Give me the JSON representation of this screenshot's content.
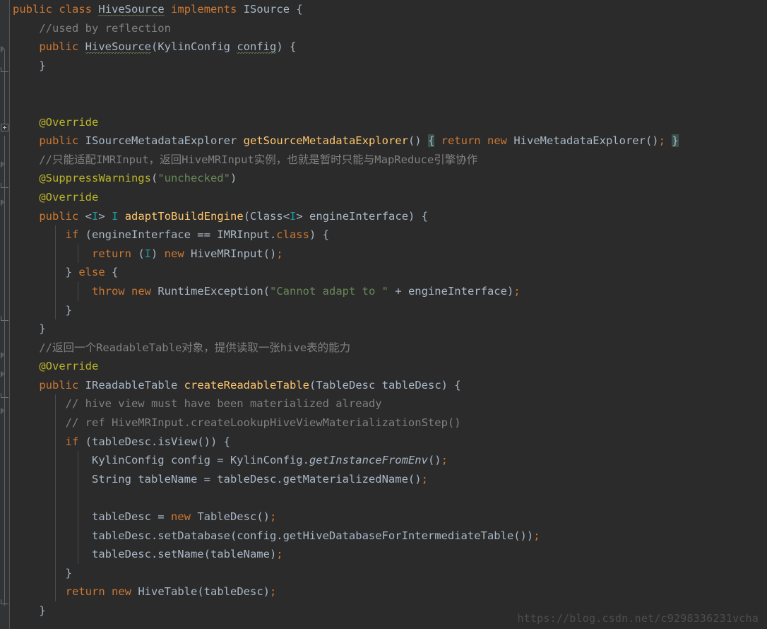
{
  "editor": {
    "theme": "darcula",
    "background_color": "#2b2b2b",
    "gutter_color": "#313335",
    "default_text_color": "#a9b7c6"
  },
  "watermark": {
    "text": "https://blog.csdn.net/c9298336231vcha",
    "color": "#4e4e4e"
  },
  "code": {
    "language": "Java",
    "lines": [
      {
        "n": 1,
        "text": "public class HiveSource implements ISource {"
      },
      {
        "n": 2,
        "text": "    //used by reflection"
      },
      {
        "n": 3,
        "text": "    public HiveSource(KylinConfig config) {"
      },
      {
        "n": 4,
        "text": "    }"
      },
      {
        "n": 5,
        "text": ""
      },
      {
        "n": 6,
        "text": ""
      },
      {
        "n": 7,
        "text": "    @Override"
      },
      {
        "n": 8,
        "text": "    public ISourceMetadataExplorer getSourceMetadataExplorer() { return new HiveMetadataExplorer(); }"
      },
      {
        "n": 9,
        "text": "    //只能适配IMRInput，返回HiveMRInput实例，也就是暂时只能与MapReduce引擎协作"
      },
      {
        "n": 10,
        "text": "    @SuppressWarnings(\"unchecked\")"
      },
      {
        "n": 11,
        "text": "    @Override"
      },
      {
        "n": 12,
        "text": "    public <I> I adaptToBuildEngine(Class<I> engineInterface) {"
      },
      {
        "n": 13,
        "text": "        if (engineInterface == IMRInput.class) {"
      },
      {
        "n": 14,
        "text": "            return (I) new HiveMRInput();"
      },
      {
        "n": 15,
        "text": "        } else {"
      },
      {
        "n": 16,
        "text": "            throw new RuntimeException(\"Cannot adapt to \" + engineInterface);"
      },
      {
        "n": 17,
        "text": "        }"
      },
      {
        "n": 18,
        "text": "    }"
      },
      {
        "n": 19,
        "text": "    //返回一个ReadableTable对象，提供读取一张hive表的能力"
      },
      {
        "n": 20,
        "text": "    @Override"
      },
      {
        "n": 21,
        "text": "    public IReadableTable createReadableTable(TableDesc tableDesc) {"
      },
      {
        "n": 22,
        "text": "        // hive view must have been materialized already"
      },
      {
        "n": 23,
        "text": "        // ref HiveMRInput.createLookupHiveViewMaterializationStep()"
      },
      {
        "n": 24,
        "text": "        if (tableDesc.isView()) {"
      },
      {
        "n": 25,
        "text": "            KylinConfig config = KylinConfig.getInstanceFromEnv();"
      },
      {
        "n": 26,
        "text": "            String tableName = tableDesc.getMaterializedName();"
      },
      {
        "n": 27,
        "text": ""
      },
      {
        "n": 28,
        "text": "            tableDesc = new TableDesc();"
      },
      {
        "n": 29,
        "text": "            tableDesc.setDatabase(config.getHiveDatabaseForIntermediateTable());"
      },
      {
        "n": 30,
        "text": "            tableDesc.setName(tableName);"
      },
      {
        "n": 31,
        "text": "        }"
      },
      {
        "n": 32,
        "text": "        return new HiveTable(tableDesc);"
      },
      {
        "n": 33,
        "text": "    }"
      }
    ]
  },
  "gutter": {
    "markers": [
      {
        "type": "fold-arrow",
        "line": 3,
        "label": "fold-region-constructor-start"
      },
      {
        "type": "fold-end",
        "line": 4,
        "label": "fold-region-constructor-end"
      },
      {
        "type": "fold-plus",
        "line": 8,
        "label": "fold-region-collapsed-method"
      },
      {
        "type": "fold-arrow",
        "line": 10,
        "label": "fold-region-annotation-start"
      },
      {
        "type": "fold-end",
        "line": 11,
        "label": "fold-region-annotation-end"
      },
      {
        "type": "fold-arrow",
        "line": 12,
        "label": "fold-region-adapt-start"
      },
      {
        "type": "fold-end",
        "line": 18,
        "label": "fold-region-adapt-end"
      },
      {
        "type": "fold-arrow",
        "line": 21,
        "label": "fold-region-create-start"
      },
      {
        "type": "fold-arrow",
        "line": 22,
        "label": "fold-region-comment-start"
      },
      {
        "type": "fold-end",
        "line": 23,
        "label": "fold-region-comment-end"
      },
      {
        "type": "fold-end",
        "line": 33,
        "label": "fold-region-create-end"
      }
    ]
  }
}
